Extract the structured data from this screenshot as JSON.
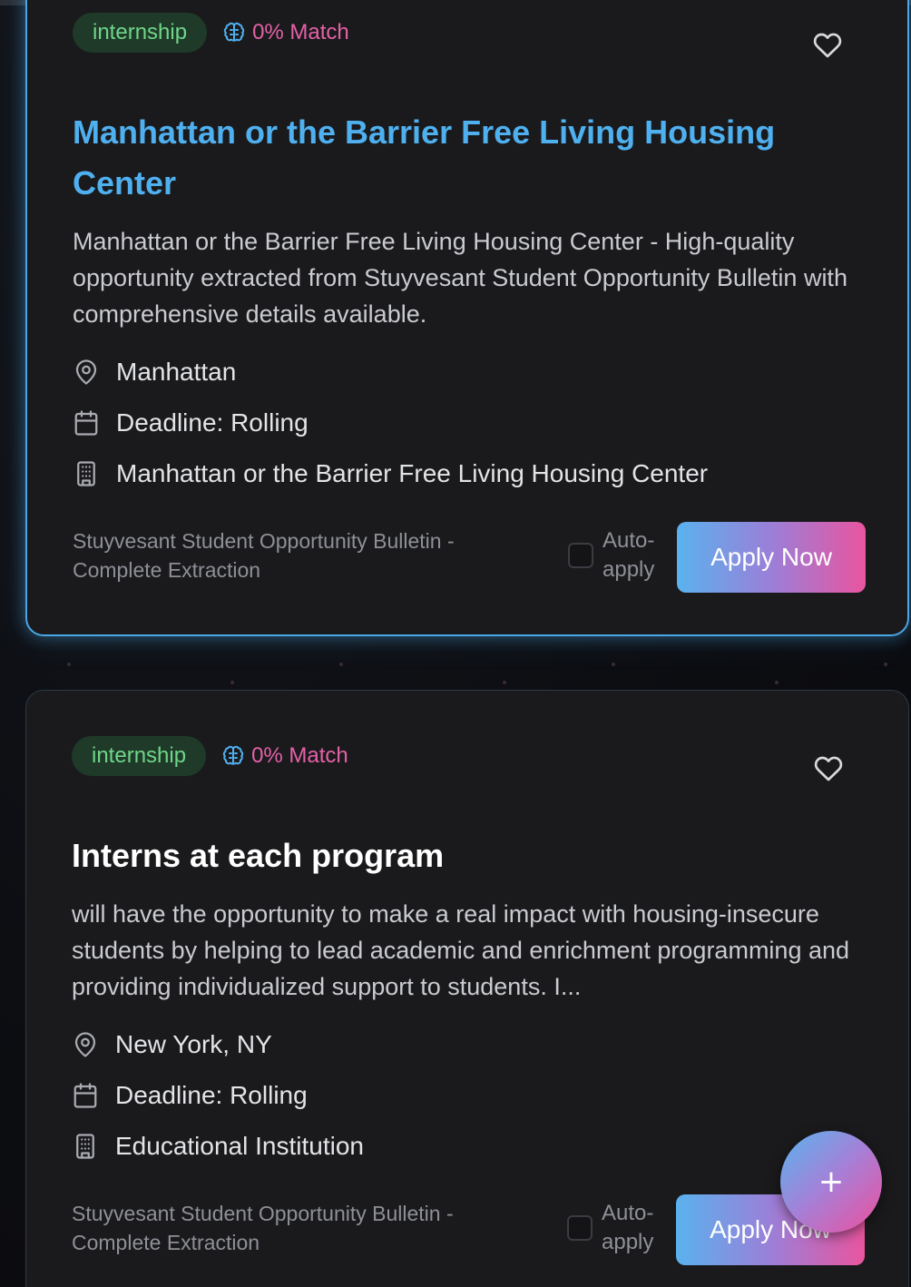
{
  "cards": [
    {
      "type_badge": "internship",
      "match": "0% Match",
      "title": "Manhattan or the Barrier Free Living Housing Center",
      "description": "Manhattan or the Barrier Free Living Housing Center - High-quality opportunity extracted from Stuyvesant Student Opportunity Bulletin with comprehensive details available.",
      "location": "Manhattan",
      "deadline": "Deadline: Rolling",
      "organization": "Manhattan or the Barrier Free Living Housing Center",
      "source": "Stuyvesant Student Opportunity Bulletin - Complete Extraction",
      "auto_apply_label": "Auto-apply",
      "auto_apply_checked": false,
      "apply_label": "Apply Now",
      "selected": true,
      "title_color": "#4fb0f0"
    },
    {
      "type_badge": "internship",
      "match": "0% Match",
      "title": "Interns at each program",
      "description": "will have the opportunity to make a real impact with housing-insecure students by helping to lead academic and enrichment programming and providing individualized support to students. I...",
      "location": "New York, NY",
      "deadline": "Deadline: Rolling",
      "organization": "Educational Institution",
      "source": "Stuyvesant Student Opportunity Bulletin - Complete Extraction",
      "auto_apply_label": "Auto-apply",
      "auto_apply_checked": false,
      "apply_label": "Apply Now",
      "selected": false,
      "title_color": "#ffffff"
    }
  ],
  "fab": {
    "label": "+"
  },
  "colors": {
    "accent_blue": "#4aa6e6",
    "accent_pink": "#e461a7",
    "badge_green": "#6fd68a",
    "card_bg": "#1a1a1c"
  },
  "icons": {
    "match": "brain-icon",
    "favorite": "heart-icon",
    "location": "map-pin-icon",
    "deadline": "calendar-icon",
    "organization": "building-icon"
  }
}
